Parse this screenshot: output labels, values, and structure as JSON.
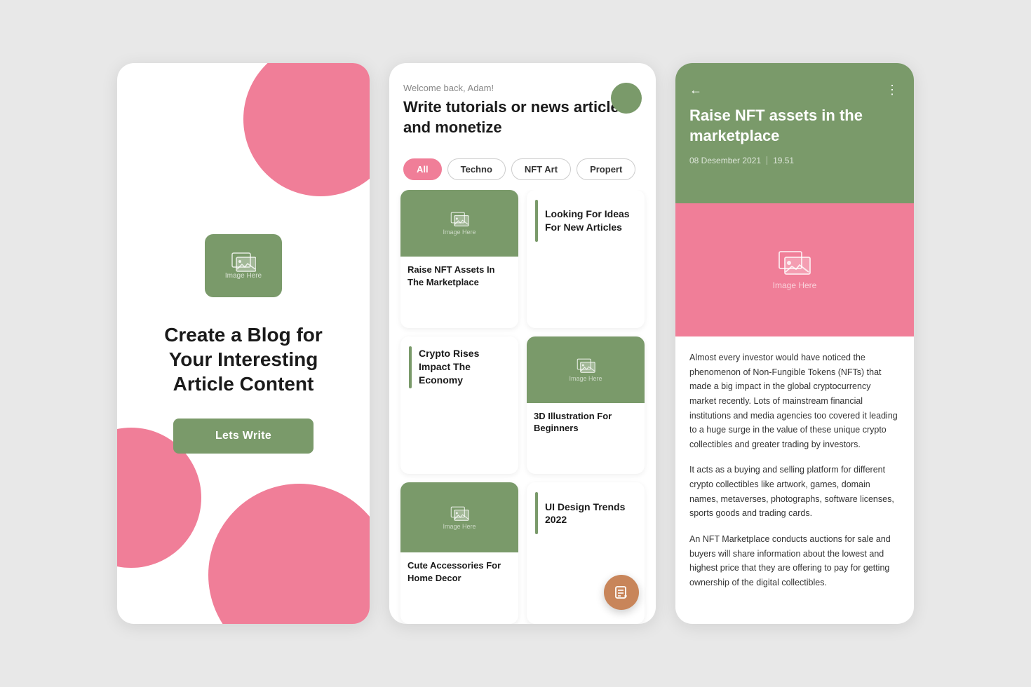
{
  "screen1": {
    "image_label": "Image Here",
    "title": "Create a Blog for Your Interesting Article Content",
    "button_label": "Lets Write"
  },
  "screen2": {
    "welcome": "Welcome back, Adam!",
    "main_title": "Write tutorials or news articles and monetize",
    "filters": [
      "All",
      "Techno",
      "NFT Art",
      "Propert"
    ],
    "active_filter": "All",
    "articles": [
      {
        "type": "image",
        "title": "Raise NFT Assets In The Marketplace",
        "has_image": true
      },
      {
        "type": "text-only",
        "title": "Looking For Ideas For New Articles"
      },
      {
        "type": "image",
        "title": "3D Illustration For Beginners",
        "has_image": true
      },
      {
        "type": "accent",
        "title": "Crypto Rises Impact The Economy"
      },
      {
        "type": "image",
        "title": "",
        "has_image": true
      },
      {
        "type": "text-only",
        "title": "UI Design Trends 2022"
      },
      {
        "type": "image",
        "title": "Cute Accessories For Home Decor",
        "has_image": true
      }
    ]
  },
  "screen3": {
    "back_label": "←",
    "more_label": "⋮",
    "title": "Raise NFT assets in the marketplace",
    "date": "08  Desember 2021",
    "time": "19.51",
    "image_label": "Image Here",
    "body_paragraphs": [
      "Almost every investor would have noticed the phenomenon of Non-Fungible Tokens (NFTs) that made a big impact in the global cryptocurrency market recently. Lots of mainstream financial institutions and media agencies too covered it leading to a huge surge in the value of these unique crypto collectibles and greater trading by investors.",
      "It acts as a buying and selling platform for different crypto collectibles like artwork, games, domain names, metaverses, photographs, software licenses, sports goods and trading cards.",
      "An NFT Marketplace conducts auctions for sale and buyers will share information about the lowest and highest price that they are offering to pay for getting ownership of the digital collectibles."
    ]
  }
}
